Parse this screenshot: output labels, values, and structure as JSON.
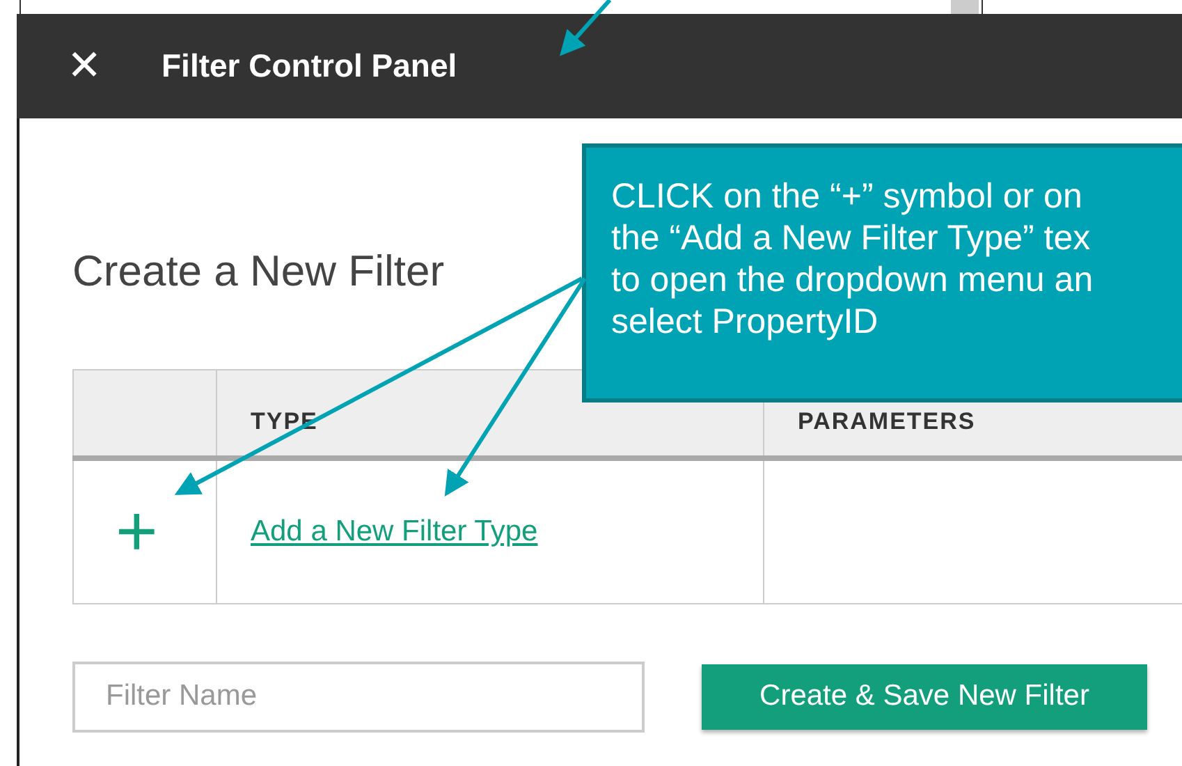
{
  "window": {
    "title": "Filter Control Panel",
    "close_icon": "✕"
  },
  "heading": "Create a New Filter",
  "table": {
    "columns": [
      "",
      "TYPE",
      "PARAMETERS"
    ],
    "rows": [
      {
        "add_symbol": "+",
        "type_link": "Add a New Filter Type"
      }
    ]
  },
  "filter_name": {
    "placeholder": "Filter Name"
  },
  "buttons": [
    "Create & Save New Filter"
  ],
  "callout": {
    "lines": [
      "CLICK on the “+” symbol or on",
      "the “Add a New Filter Type” tex",
      "to open the dropdown menu an",
      "select PropertyID"
    ]
  }
}
